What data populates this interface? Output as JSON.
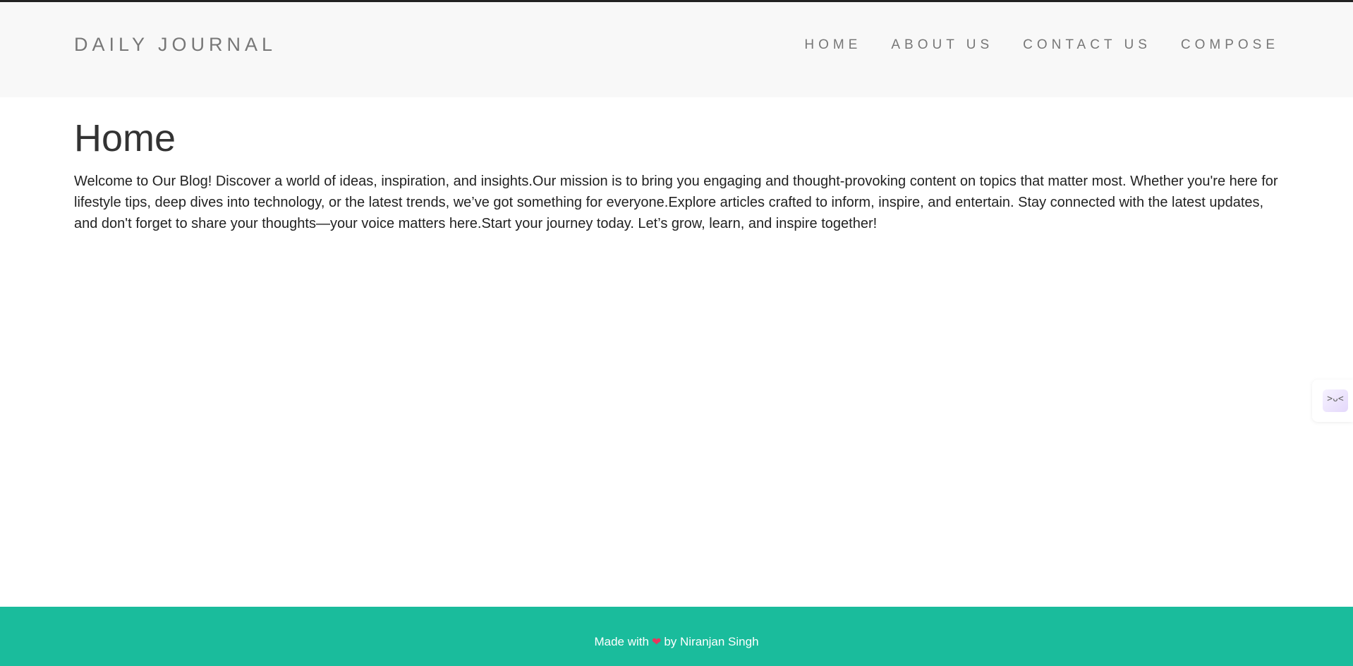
{
  "brand": "DAILY JOURNAL",
  "nav": [
    {
      "label": "HOME"
    },
    {
      "label": "ABOUT US"
    },
    {
      "label": "CONTACT US"
    },
    {
      "label": "COMPOSE"
    }
  ],
  "main": {
    "title": "Home",
    "body": "Welcome to Our Blog! Discover a world of ideas, inspiration, and insights.Our mission is to bring you engaging and thought-provoking content on topics that matter most. Whether you're here for lifestyle tips, deep dives into technology, or the latest trends, we’ve got something for everyone.Explore articles crafted to inform, inspire, and entertain. Stay connected with the latest updates, and don't forget to share your thoughts—your voice matters here.Start your journey today. Let’s grow, learn, and inspire together!"
  },
  "side_widget": {
    "icon": "sleepy-face-icon",
    "glyph": ">ᴗ<"
  },
  "footer": {
    "prefix": "Made with",
    "heart": "❤",
    "suffix": "by Niranjan Singh"
  },
  "colors": {
    "navbar_bg": "#f8f8f8",
    "footer_bg": "#1abc9c",
    "nav_text": "#777777",
    "heart": "#e8365d"
  }
}
